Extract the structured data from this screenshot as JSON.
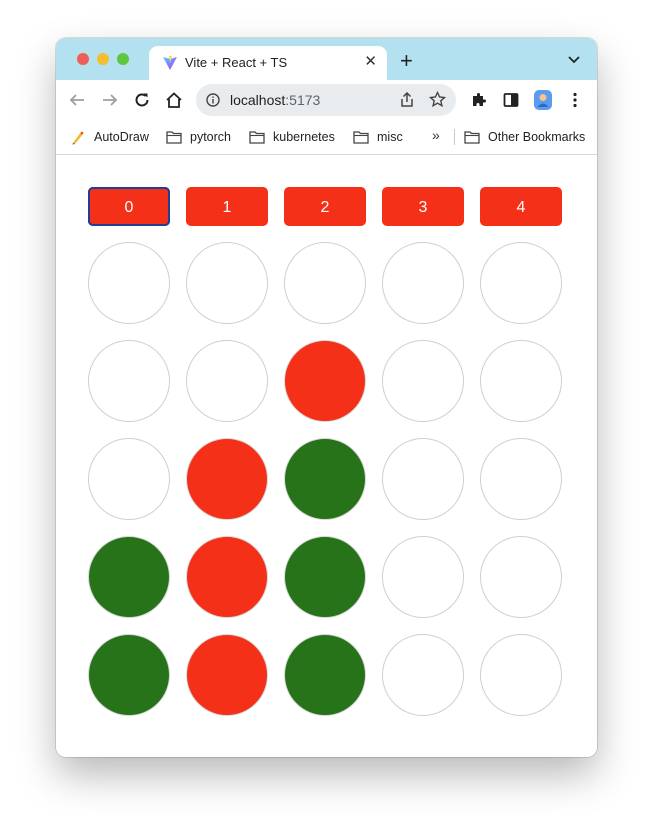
{
  "browser": {
    "tab": {
      "title": "Vite + React + TS",
      "close": "✕"
    },
    "new_tab": "+",
    "omnibox": {
      "host": "localhost",
      "port": ":5173"
    },
    "bookmarks": [
      {
        "label": "AutoDraw",
        "icon": "autodraw-icon"
      },
      {
        "label": "pytorch",
        "icon": "folder-icon"
      },
      {
        "label": "kubernetes",
        "icon": "folder-icon"
      },
      {
        "label": "misc",
        "icon": "folder-icon"
      }
    ],
    "bookmarks_more": "»",
    "other_bookmarks": "Other Bookmarks"
  },
  "game": {
    "column_buttons": [
      "0",
      "1",
      "2",
      "3",
      "4"
    ],
    "focused_column": 0,
    "colors": {
      "red": "#f43018",
      "green": "#26731a",
      "empty": "#ffffff"
    },
    "grid": [
      [
        "empty",
        "empty",
        "empty",
        "empty",
        "empty"
      ],
      [
        "empty",
        "empty",
        "red",
        "empty",
        "empty"
      ],
      [
        "empty",
        "red",
        "green",
        "empty",
        "empty"
      ],
      [
        "green",
        "red",
        "green",
        "empty",
        "empty"
      ],
      [
        "green",
        "red",
        "green",
        "empty",
        "empty"
      ]
    ]
  }
}
